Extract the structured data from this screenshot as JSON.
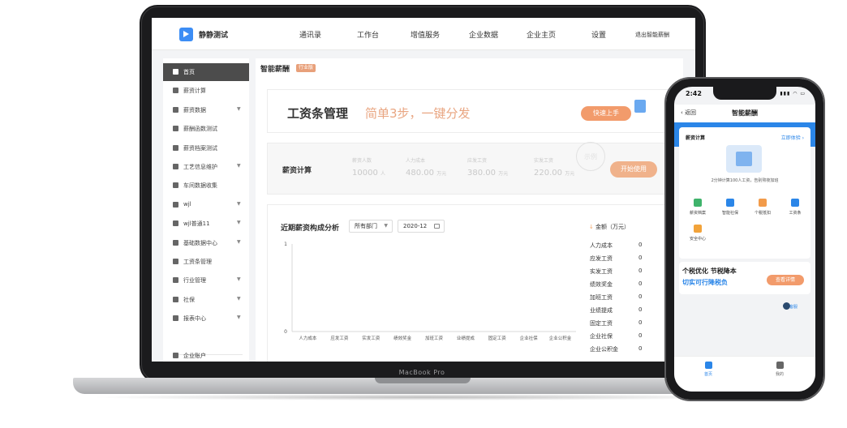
{
  "laptop": {
    "model_label": "MacBook Pro",
    "nav": {
      "brand": "静静测试",
      "items": [
        "通讯录",
        "工作台",
        "增值服务",
        "企业数据",
        "企业主页",
        "设置"
      ],
      "exit": "退出智能薪酬"
    },
    "sidebar": {
      "items": [
        {
          "label": "首页",
          "active": true,
          "caret": false
        },
        {
          "label": "薪资计算",
          "active": false,
          "caret": false
        },
        {
          "label": "薪资数据",
          "active": false,
          "caret": true
        },
        {
          "label": "薪酬函数测试",
          "active": false,
          "caret": false
        },
        {
          "label": "薪资档案测试",
          "active": false,
          "caret": false
        },
        {
          "label": "工艺信息维护",
          "active": false,
          "caret": true
        },
        {
          "label": "车间数据收集",
          "active": false,
          "caret": false
        },
        {
          "label": "wjl",
          "active": false,
          "caret": true
        },
        {
          "label": "wjl普通11",
          "active": false,
          "caret": true
        },
        {
          "label": "基础数据中心",
          "active": false,
          "caret": true
        },
        {
          "label": "工资条管理",
          "active": false,
          "caret": false
        },
        {
          "label": "行业管理",
          "active": false,
          "caret": true
        },
        {
          "label": "社保",
          "active": false,
          "caret": true
        },
        {
          "label": "报表中心",
          "active": false,
          "caret": true
        }
      ],
      "account": "企业账户"
    },
    "page": {
      "title": "智能薪酬",
      "badge": "行业版"
    },
    "banner": {
      "heading": "工资条管理",
      "subheading": "简单3步，一键分发",
      "button": "快速上手"
    },
    "calc": {
      "title": "薪资计算",
      "stamp": "示例",
      "stats": [
        {
          "label": "薪资人数",
          "value": "10000",
          "unit": "人"
        },
        {
          "label": "人力成本",
          "value": "480.00",
          "unit": "万元"
        },
        {
          "label": "应发工资",
          "value": "380.00",
          "unit": "万元"
        },
        {
          "label": "实发工资",
          "value": "220.00",
          "unit": "万元"
        }
      ],
      "button": "开始使用"
    },
    "analysis": {
      "title": "近期薪资构成分析",
      "dept_select": "所有部门",
      "date_select": "2020-12",
      "legend_title": "金额（万元）",
      "legend": [
        {
          "label": "人力成本",
          "value": "0"
        },
        {
          "label": "应发工资",
          "value": "0"
        },
        {
          "label": "实发工资",
          "value": "0"
        },
        {
          "label": "绩效奖金",
          "value": "0"
        },
        {
          "label": "加班工资",
          "value": "0"
        },
        {
          "label": "业绩提成",
          "value": "0"
        },
        {
          "label": "固定工资",
          "value": "0"
        },
        {
          "label": "企业社保",
          "value": "0"
        },
        {
          "label": "企业公积金",
          "value": "0"
        }
      ]
    }
  },
  "chart_data": {
    "type": "bar",
    "categories": [
      "人力成本",
      "应发工资",
      "实发工资",
      "绩效奖金",
      "加班工资",
      "业绩提成",
      "固定工资",
      "企业社保",
      "企业公积金"
    ],
    "values": [
      0,
      0,
      0,
      0,
      0,
      0,
      0,
      0,
      0
    ],
    "ylim": [
      0,
      1
    ],
    "yticks": [
      "0",
      "1"
    ],
    "grid": false
  },
  "phone": {
    "time": "2:42",
    "status": "▮▮▮ ◠ ▭",
    "back": "返回",
    "title": "智能薪酬",
    "card": {
      "title": "薪资计算",
      "link": "立即体验 ›",
      "desc": "2分钟计算100人工资，告别熬夜加班"
    },
    "icons": [
      {
        "label": "薪资档案",
        "color": "#3fb36b"
      },
      {
        "label": "智能社保",
        "color": "#2b86e8"
      },
      {
        "label": "个税抵扣",
        "color": "#f29b4a"
      },
      {
        "label": "工资条",
        "color": "#2b86e8"
      },
      {
        "label": "安全中心",
        "color": "#f2a33a"
      }
    ],
    "banner": {
      "heading": "个税优化 节税降本",
      "sub": "切实可行降税负",
      "button": "查看详情"
    },
    "service": "客服",
    "tabs": [
      {
        "label": "首页",
        "active": true
      },
      {
        "label": "我的",
        "active": false
      }
    ]
  },
  "colors": {
    "accent_orange": "#f29b6b",
    "brand_blue": "#2b86e8",
    "sidebar_active": "#4c4c4c"
  }
}
